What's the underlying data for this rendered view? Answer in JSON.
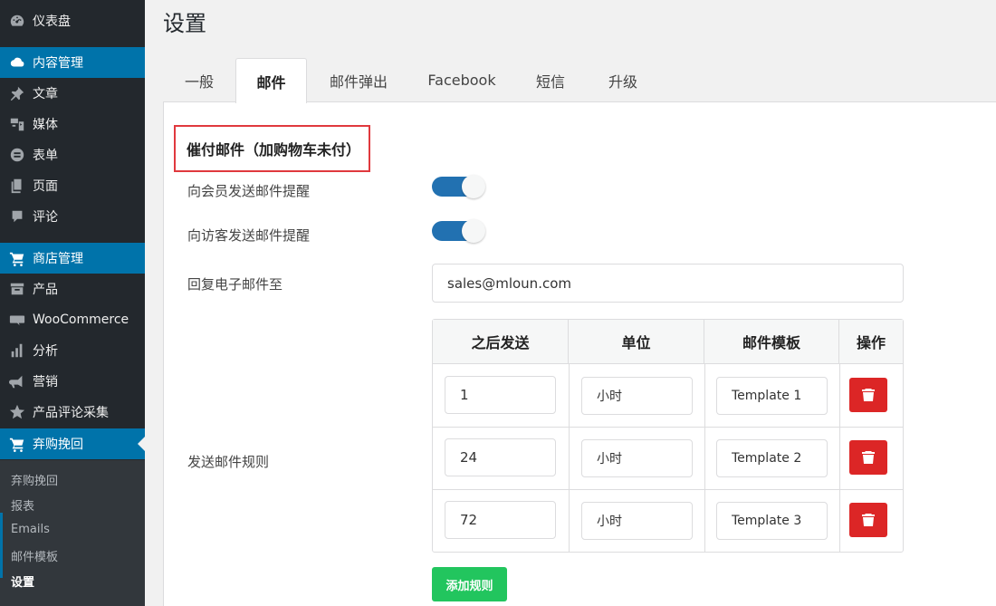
{
  "sidebar": {
    "items": [
      {
        "label": "仪表盘"
      },
      {
        "label": "内容管理"
      },
      {
        "label": "文章"
      },
      {
        "label": "媒体"
      },
      {
        "label": "表单"
      },
      {
        "label": "页面"
      },
      {
        "label": "评论"
      },
      {
        "label": "商店管理"
      },
      {
        "label": "产品"
      },
      {
        "label": "WooCommerce"
      },
      {
        "label": "分析"
      },
      {
        "label": "营销"
      },
      {
        "label": "产品评论采集"
      },
      {
        "label": "弃购挽回"
      }
    ],
    "submenu": [
      {
        "label": "弃购挽回"
      },
      {
        "label": "报表"
      },
      {
        "label": "Emails"
      },
      {
        "label": "邮件模板"
      },
      {
        "label": "设置"
      }
    ]
  },
  "page": {
    "title": "设置"
  },
  "tabs": [
    {
      "label": "一般"
    },
    {
      "label": "邮件"
    },
    {
      "label": "邮件弹出"
    },
    {
      "label": "Facebook"
    },
    {
      "label": "短信"
    },
    {
      "label": "升级"
    }
  ],
  "settings": {
    "section_title": "催付邮件（加购物车未付）",
    "member_reminder_label": "向会员发送邮件提醒",
    "guest_reminder_label": "向访客发送邮件提醒",
    "reply_to_label": "回复电子邮件至",
    "reply_to_value": "sales@mloun.com",
    "rules_label": "发送邮件规则",
    "add_rule_label": "添加规则"
  },
  "rules": {
    "headers": [
      "之后发送",
      "单位",
      "邮件模板",
      "操作"
    ],
    "rows": [
      {
        "after": "1",
        "unit": "小时",
        "template": "Template 1"
      },
      {
        "after": "24",
        "unit": "小时",
        "template": "Template 2"
      },
      {
        "after": "72",
        "unit": "小时",
        "template": "Template 3"
      }
    ]
  },
  "colors": {
    "sidebar_bg": "#23282d",
    "active_bg": "#0073aa",
    "highlight_border": "#e0393e",
    "toggle_on": "#2271b1",
    "delete_red": "#dc2626",
    "add_green": "#22c55e"
  }
}
